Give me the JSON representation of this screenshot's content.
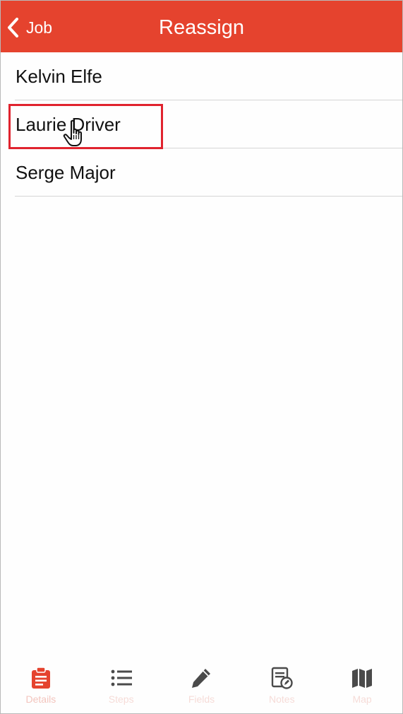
{
  "navbar": {
    "back_label": "Job",
    "title": "Reassign",
    "background": "#e5432e"
  },
  "assignees": [
    {
      "name": "Kelvin Elfe"
    },
    {
      "name": "Laurie Driver",
      "highlighted": true
    },
    {
      "name": "Serge Major"
    }
  ],
  "tabbar": {
    "tabs": [
      {
        "label": "Details",
        "icon": "clipboard-icon",
        "active": true
      },
      {
        "label": "Steps",
        "icon": "list-icon"
      },
      {
        "label": "Fields",
        "icon": "pencil-icon"
      },
      {
        "label": "Notes",
        "icon": "note-edit-icon"
      },
      {
        "label": "Map",
        "icon": "map-icon"
      }
    ]
  },
  "colors": {
    "accent": "#e5432e",
    "active_tab_icon": "#e5432e",
    "inactive_tab_icon": "#4a4a4a",
    "highlight_box": "#e0232e"
  }
}
